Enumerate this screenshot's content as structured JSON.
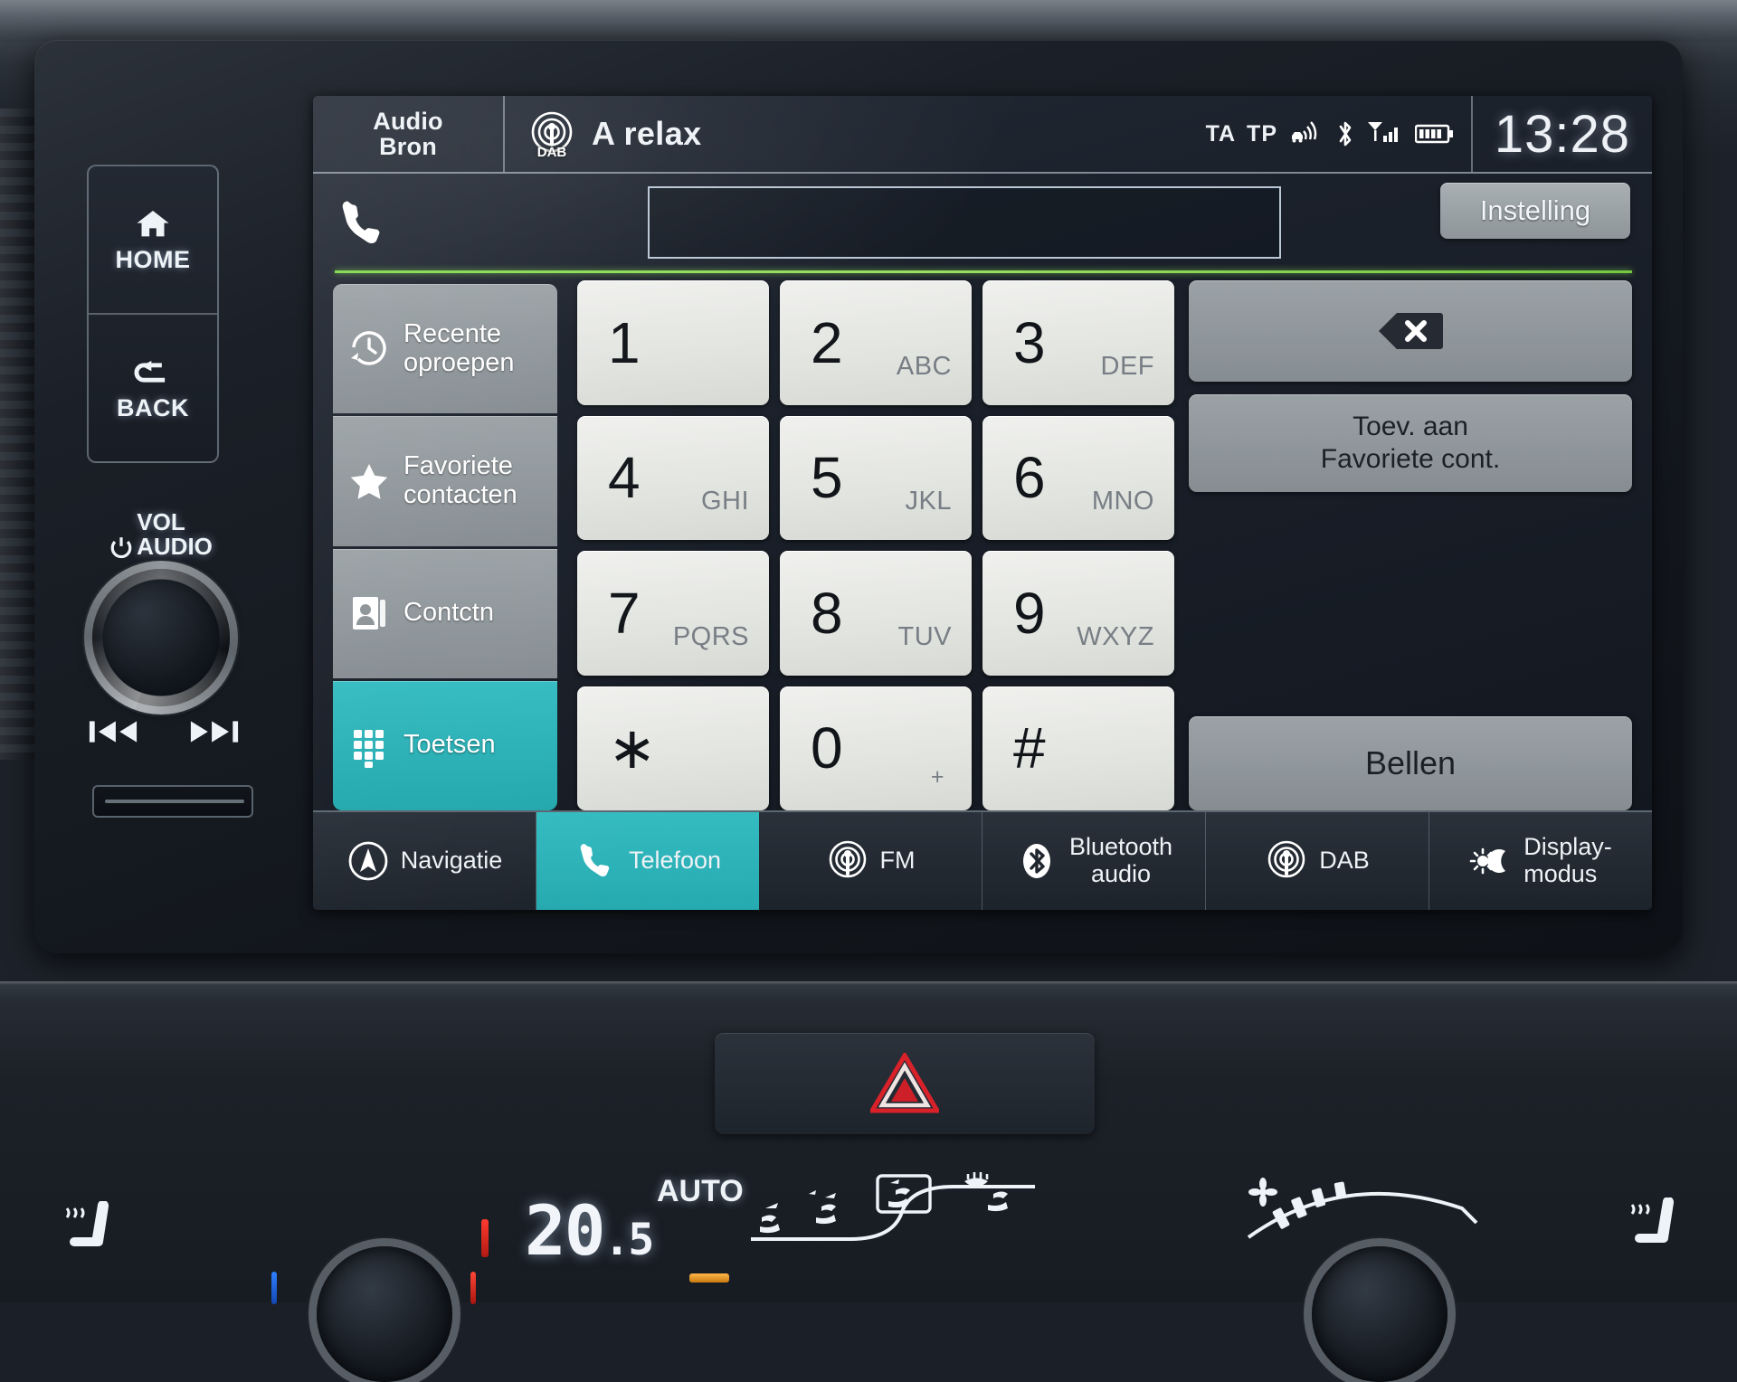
{
  "status_bar": {
    "audio_source_line1": "Audio",
    "audio_source_line2": "Bron",
    "band_badge": "DAB",
    "station_name": "A relax",
    "traffic_announcement": "TA",
    "traffic_program": "TP",
    "clock": "13:28",
    "icons": [
      "car-antenna-icon",
      "bluetooth-icon",
      "signal-bars-icon",
      "battery-icon"
    ]
  },
  "phone_entry": {
    "phone_icon": "phone-handset-icon",
    "number_value": "",
    "number_placeholder": "",
    "settings_button": "Instelling"
  },
  "sidebar": {
    "items": [
      {
        "label": "Recente\noproepen",
        "icon": "recent-calls-clock-icon",
        "active": false
      },
      {
        "label": "Favoriete\ncontacten",
        "icon": "star-icon",
        "active": false
      },
      {
        "label": "Contctn",
        "icon": "contacts-book-icon",
        "active": false
      },
      {
        "label": "Toetsen",
        "icon": "keypad-icon",
        "active": true
      }
    ]
  },
  "keypad": {
    "keys": [
      {
        "digit": "1",
        "letters": ""
      },
      {
        "digit": "2",
        "letters": "ABC"
      },
      {
        "digit": "3",
        "letters": "DEF"
      },
      {
        "digit": "4",
        "letters": "GHI"
      },
      {
        "digit": "5",
        "letters": "JKL"
      },
      {
        "digit": "6",
        "letters": "MNO"
      },
      {
        "digit": "7",
        "letters": "PQRS"
      },
      {
        "digit": "8",
        "letters": "TUV"
      },
      {
        "digit": "9",
        "letters": "WXYZ"
      },
      {
        "digit": "∗",
        "letters": ""
      },
      {
        "digit": "0",
        "letters": "+"
      },
      {
        "digit": "#",
        "letters": ""
      }
    ]
  },
  "actions": {
    "backspace_icon": "backspace-delete-icon",
    "add_favorite_label": "Toev. aan\nFavoriete cont.",
    "call_label": "Bellen"
  },
  "tab_bar": {
    "tabs": [
      {
        "label": "Navigatie",
        "icon": "navigation-compass-icon",
        "active": false
      },
      {
        "label": "Telefoon",
        "icon": "phone-handset-icon",
        "active": true
      },
      {
        "label": "FM",
        "icon": "radio-broadcast-icon",
        "active": false
      },
      {
        "label": "Bluetooth\naudio",
        "icon": "bluetooth-icon",
        "active": false
      },
      {
        "label": "DAB",
        "icon": "radio-broadcast-icon",
        "active": false
      },
      {
        "label": "Display-\nmodus",
        "icon": "brightness-moon-icon",
        "active": false
      }
    ]
  },
  "hardware": {
    "home_button": "HOME",
    "back_button": "BACK",
    "volume_line1": "VOL",
    "volume_line2": "AUDIO",
    "power_icon": "power-icon",
    "prev_track_icon": "previous-track-icon",
    "next_track_icon": "next-track-icon"
  },
  "climate": {
    "temperature_whole": "20",
    "temperature_decimal": ".5",
    "auto_label": "AUTO",
    "hazard_icon": "hazard-warning-triangle-icon",
    "airflow_icons": [
      "airflow-face-icon",
      "airflow-face-feet-icon",
      "airflow-feet-icon",
      "defrost-icon"
    ],
    "fan_icon": "fan-speed-icon",
    "seat_heater_left_icon": "heated-seat-icon",
    "seat_heater_right_icon": "heated-seat-icon"
  },
  "colors": {
    "accent_teal": "#2BB3B8",
    "screen_bg": "#1b212b",
    "key_face": "#e4e6e2",
    "panel_gray": "#8f969a",
    "green_underline": "#8cdb55"
  }
}
